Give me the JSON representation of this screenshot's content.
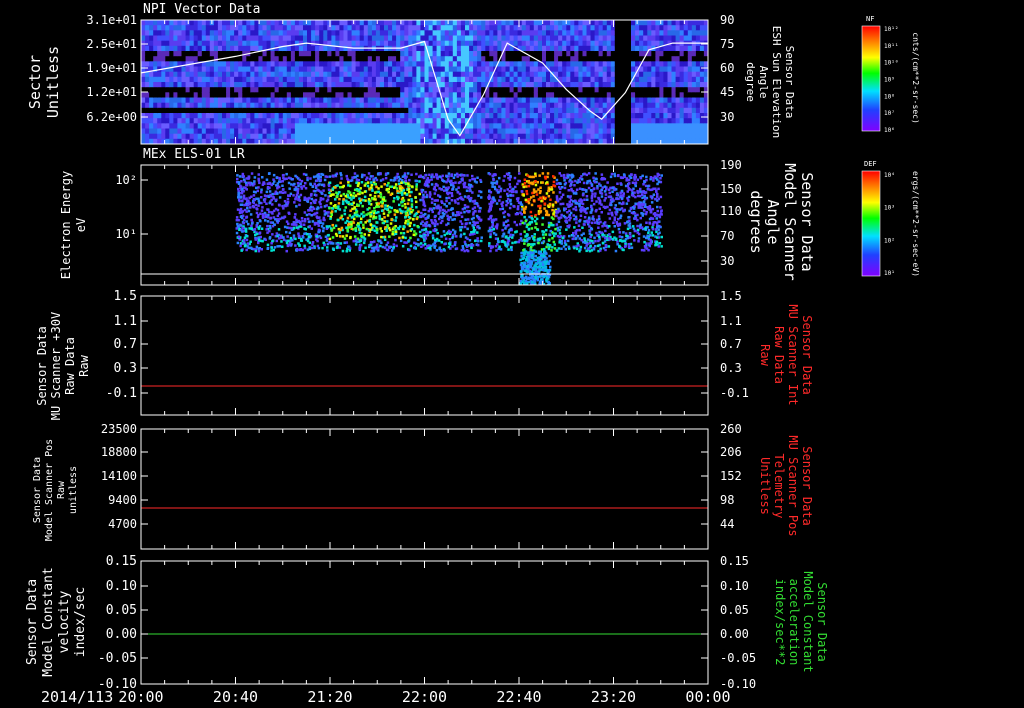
{
  "colors": {
    "background": "#000000",
    "axes": "#ffffff",
    "red_series": "#ff2a2a",
    "green_series": "#33dd33",
    "white_line": "#ffffff"
  },
  "footer": {
    "date": "2014/113"
  },
  "time_axis": {
    "start": "20:00",
    "end": "00:00",
    "tick_labels": [
      "20:00",
      "20:40",
      "21:20",
      "22:00",
      "22:40",
      "23:20",
      "00:00"
    ]
  },
  "chart_data": [
    {
      "type": "heatmap",
      "title": "NPI Vector Data",
      "ylabel": [
        "Sector",
        "Unitless"
      ],
      "y_tick_labels": [
        "3.1e+01",
        "2.5e+01",
        "1.9e+01",
        "1.2e+01",
        "6.2e+00"
      ],
      "y2label": [
        "Sensor Data",
        "ESH Sun Elevation",
        "Angle",
        "degree"
      ],
      "y2_tick_labels": [
        "90",
        "75",
        "60",
        "45",
        "30"
      ],
      "y2lim": [
        15,
        90
      ],
      "colorbar": {
        "title": "NF",
        "unit": "cnts/(cm**2-sr-sec)",
        "tick_labels": [
          "10¹²",
          "10¹¹",
          "10¹⁰",
          "10⁹",
          "10⁸",
          "10⁷",
          "10⁶"
        ]
      },
      "line_series": {
        "x": [
          "20:00",
          "20:40",
          "21:00",
          "21:10",
          "21:30",
          "21:50",
          "22:00",
          "22:10",
          "22:15",
          "22:25",
          "22:35",
          "22:50",
          "23:00",
          "23:10",
          "23:15",
          "23:25",
          "23:35",
          "23:45",
          "00:00"
        ],
        "y": [
          58,
          68,
          74,
          76,
          73,
          73,
          77,
          30,
          20,
          45,
          76,
          64,
          48,
          35,
          30,
          46,
          72,
          76,
          76
        ]
      }
    },
    {
      "type": "heatmap",
      "title": "MEx ELS-01 LR",
      "ylabel": [
        "Electron Energy",
        "eV"
      ],
      "y_tick_labels": [
        "10²",
        "10¹"
      ],
      "y2label": [
        "Sensor Data",
        "Model Scanner",
        "Angle",
        "degrees"
      ],
      "y2_tick_labels": [
        "190",
        "150",
        "110",
        "70",
        "30"
      ],
      "colorbar": {
        "title": "DEF",
        "unit": "ergs/(cm**2-sr-sec-eV)",
        "tick_labels": [
          "10⁴",
          "10³",
          "10²",
          "10¹"
        ]
      },
      "line_series": {
        "x": [
          "20:00",
          "00:00"
        ],
        "y": [
          10,
          10
        ]
      }
    },
    {
      "type": "line",
      "ylabel": [
        "Sensor Data",
        "MU Scanner +30V",
        "Raw Data",
        "Raw"
      ],
      "y_tick_labels": [
        "1.5",
        "1.1",
        "0.7",
        "0.3",
        "-0.1"
      ],
      "ylim": [
        -0.35,
        1.5
      ],
      "y2label": [
        "Sensor Data",
        "MU Scanner Int",
        "Raw Data",
        "Raw"
      ],
      "y2_tick_labels": [
        "1.5",
        "1.1",
        "0.7",
        "0.3",
        "-0.1"
      ],
      "series": [
        {
          "x": [
            "20:00",
            "00:00"
          ],
          "y": [
            0.0,
            0.0
          ]
        }
      ]
    },
    {
      "type": "line",
      "ylabel": [
        "Sensor Data",
        "Model Scanner Pos",
        "Raw",
        "unitless"
      ],
      "y_tick_labels": [
        "23500",
        "18800",
        "14100",
        "9400",
        "4700"
      ],
      "ylim": [
        0,
        23500
      ],
      "y2label": [
        "Sensor Data",
        "MU Scanner Pos",
        "Telemetry",
        "Unitless"
      ],
      "y2_tick_labels": [
        "260",
        "206",
        "152",
        "98",
        "44"
      ],
      "series": [
        {
          "x": [
            "20:00",
            "00:00"
          ],
          "y": [
            8200,
            8200
          ]
        }
      ]
    },
    {
      "type": "line",
      "ylabel": [
        "Sensor Data",
        "Model Constant",
        "velocity",
        "index/sec"
      ],
      "y_tick_labels": [
        "0.15",
        "0.10",
        "0.05",
        "0.00",
        "-0.05",
        "-0.10"
      ],
      "ylim": [
        -0.1,
        0.15
      ],
      "y2label": [
        "Sensor Data",
        "Model Constant",
        "acceleration",
        "index/sec**2"
      ],
      "y2_tick_labels": [
        "0.15",
        "0.10",
        "0.05",
        "0.00",
        "-0.05",
        "-0.10"
      ],
      "series": [
        {
          "x": [
            "20:00",
            "00:00"
          ],
          "y": [
            0.0,
            0.0
          ]
        }
      ]
    }
  ]
}
